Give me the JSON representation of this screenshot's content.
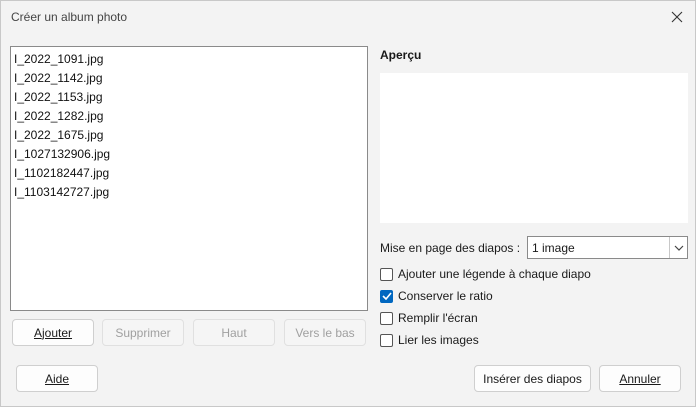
{
  "window": {
    "title": "Créer un album photo",
    "close_icon": "close-icon"
  },
  "files": [
    "I_2022_1091.jpg",
    "I_2022_1142.jpg",
    "I_2022_1153.jpg",
    "I_2022_1282.jpg",
    "I_2022_1675.jpg",
    "I_1027132906.jpg",
    "I_1102182447.jpg",
    "I_1103142727.jpg"
  ],
  "list_buttons": {
    "add": "Ajouter",
    "remove": "Supprimer",
    "up": "Haut",
    "down": "Vers le bas"
  },
  "preview": {
    "label": "Aperçu"
  },
  "layout": {
    "label": "Mise en page des diapos :",
    "selected": "1 image"
  },
  "options": [
    {
      "label": "Ajouter une légende à chaque diapo",
      "checked": false
    },
    {
      "label": "Conserver le ratio",
      "checked": true
    },
    {
      "label": "Remplir l'écran",
      "checked": false
    },
    {
      "label": "Lier les images",
      "checked": false
    }
  ],
  "footer": {
    "help": "Aide",
    "insert": "Insérer des diapos",
    "cancel": "Annuler"
  },
  "colors": {
    "accent": "#0067c0",
    "dialog_bg": "#f3f3f3",
    "disabled_text": "#a0a0a0"
  }
}
